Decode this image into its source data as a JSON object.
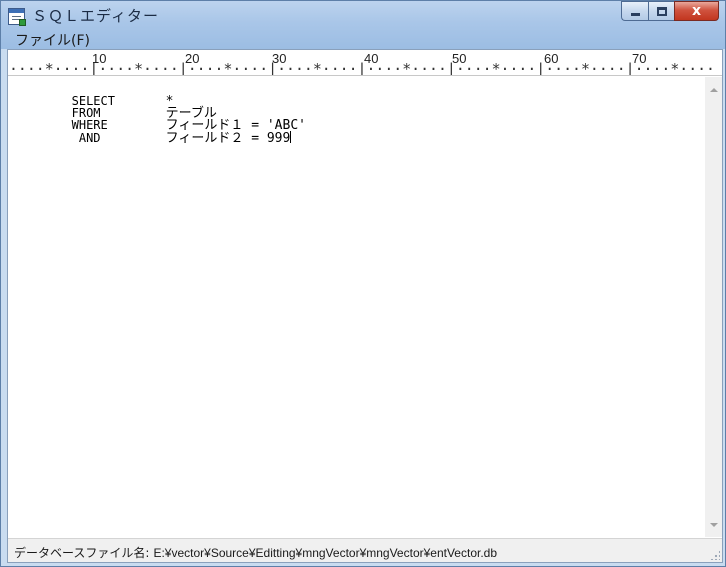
{
  "window": {
    "title": "ＳＱＬエディター",
    "close_glyph": "x",
    "icon": "sql-editor-app-icon"
  },
  "menu": {
    "items": [
      {
        "label": "ファイル(F)"
      }
    ]
  },
  "ruler": {
    "numbers": [
      "10",
      "20",
      "30",
      "40",
      "50",
      "60",
      "70"
    ],
    "marks": "····*····|····*····|····*····|····*····|····*····|····*····|····*····|····*····"
  },
  "editor": {
    "lines": [
      {
        "keyword": "SELECT",
        "content": "*"
      },
      {
        "keyword": "FROM",
        "content": "テーブル"
      },
      {
        "keyword": "WHERE",
        "content": "フィールド１ = 'ABC'"
      },
      {
        "keyword": " AND",
        "content": "フィールド２ = 999"
      }
    ]
  },
  "status": {
    "label": "データベースファイル名:",
    "path": "E:¥vector¥Source¥Editting¥mngVector¥mngVector¥entVector.db"
  },
  "colors": {
    "titlebar": "#a9c6e8",
    "close_button": "#c2361f",
    "editor_bg": "#ffffff",
    "statusbar_bg": "#f0f0f0"
  }
}
